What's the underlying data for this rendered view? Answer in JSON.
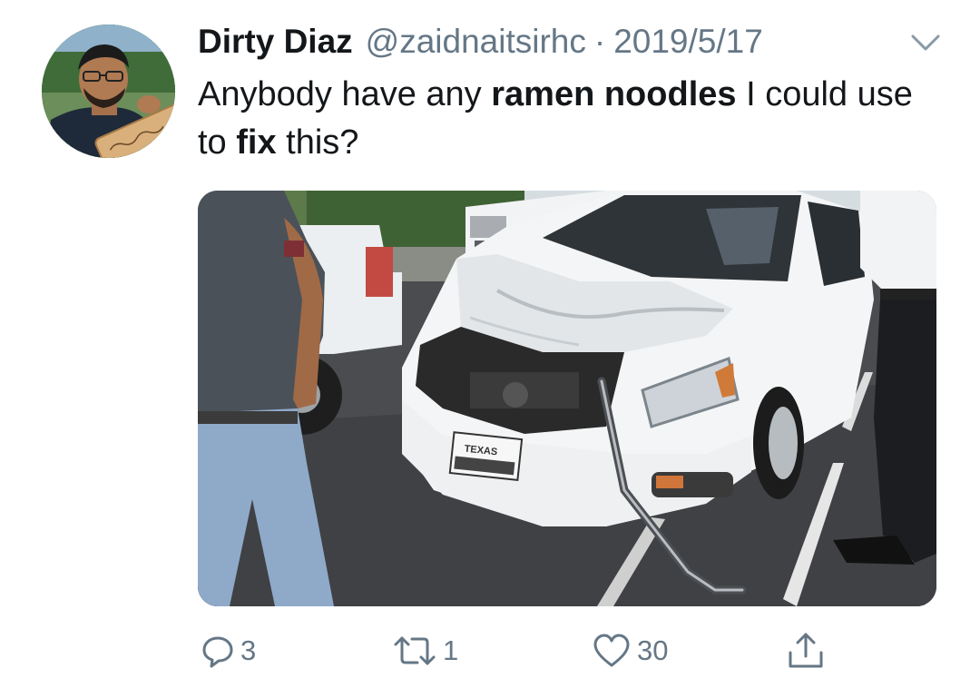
{
  "tweet": {
    "display_name": "Dirty Diaz",
    "handle": "@zaidnaitsirhc",
    "separator": "·",
    "date": "2019/5/17",
    "text_parts": [
      "Anybody have any ",
      "ramen noodles",
      " I could use to ",
      "fix",
      " this?"
    ],
    "avatar_icon": "profile-photo",
    "menu_icon": "chevron-down-icon",
    "media_description_icon": "crashed-white-car-photo",
    "plate_text": "TEXAS"
  },
  "actions": {
    "reply_count": "3",
    "retweet_count": "1",
    "like_count": "30"
  },
  "colors": {
    "text_primary": "#14171a",
    "text_secondary": "#657786",
    "background": "#ffffff"
  }
}
